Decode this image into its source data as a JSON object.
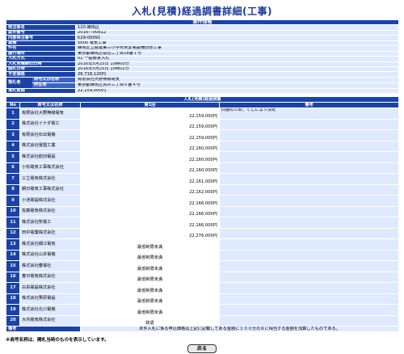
{
  "page_title": "入札(見積)経過調書詳細(工事)",
  "case_info": {
    "section_title": "案件情報",
    "rows": [
      {
        "label": "発注係名",
        "value": "120 練馬区"
      },
      {
        "label": "案件番号",
        "value": "2016---00812"
      },
      {
        "label": "内部発注番号",
        "value": "K28-00091"
      },
      {
        "label": "業種",
        "value": "5600 電気工事"
      },
      {
        "label": "件名",
        "value": "練馬区立開進第三小学校受変電設備改修工事"
      },
      {
        "label": "履行場所",
        "value": "東京都練馬区桜台二丁目18番１号"
      },
      {
        "label": "入札方式",
        "value": "01 一般競争入札"
      },
      {
        "label": "入札見積締切日時",
        "value": "2016年5月25日 10時00分"
      },
      {
        "label": "開札日時",
        "value": "2016年5月25日 10時02分"
      },
      {
        "label": "予定価格",
        "value": "26,718,120円"
      }
    ],
    "winner": {
      "label": "落札者",
      "sub1_label": "商号又は名称",
      "sub1_value": "有限会社大野無線電気",
      "sub2_label": "所在地",
      "sub2_value": "東京都練馬区貫井三丁目６番４号"
    },
    "price_label": "落札金額",
    "price_value": "22,159,000円"
  },
  "bid_table": {
    "section_title": "入札(見積)経過調書",
    "headers": {
      "no": "No",
      "name": "商号又は名称",
      "round": "第1回",
      "note": "備考"
    },
    "rows": [
      {
        "no": "1",
        "name": "有限会社大野無線電気",
        "amount": "22,159,000円",
        "note": "同額のため、くじにより決定"
      },
      {
        "no": "2",
        "name": "株式会社イナダ電工",
        "amount": "22,159,000円",
        "note": ""
      },
      {
        "no": "3",
        "name": "有限会社石出電機",
        "amount": "22,159,000円",
        "note": ""
      },
      {
        "no": "4",
        "name": "株式会社電盟工業",
        "amount": "22,160,000円",
        "note": ""
      },
      {
        "no": "5",
        "name": "株式会社欽旧電設",
        "amount": "22,160,000円",
        "note": ""
      },
      {
        "no": "6",
        "name": "小松電気工事株式会社",
        "amount": "22,160,000円",
        "note": ""
      },
      {
        "no": "7",
        "name": "三立電気株式会社",
        "amount": "22,161,000円",
        "note": ""
      },
      {
        "no": "8",
        "name": "朝日電気工事株式会社",
        "amount": "22,162,000円",
        "note": ""
      },
      {
        "no": "9",
        "name": "小池電設株式会社",
        "amount": "22,166,000円",
        "note": ""
      },
      {
        "no": "10",
        "name": "佐藤電気株式会社",
        "amount": "22,166,000円",
        "note": ""
      },
      {
        "no": "11",
        "name": "株式会社牧電工",
        "amount": "22,166,000円",
        "note": ""
      },
      {
        "no": "12",
        "name": "田中電業株式会社",
        "amount": "22,276,000円",
        "note": ""
      },
      {
        "no": "13",
        "name": "株式会社細江電気",
        "amount": "最低制限未満",
        "note": ""
      },
      {
        "no": "14",
        "name": "株式会社山本電機",
        "amount": "最低制限未満",
        "note": ""
      },
      {
        "no": "15",
        "name": "株式会社春電社",
        "amount": "最低制限未満",
        "note": ""
      },
      {
        "no": "16",
        "name": "春日電気株式会社",
        "amount": "最低制限未満",
        "note": ""
      },
      {
        "no": "17",
        "name": "白鳥電設株式会社",
        "amount": "最低制限未満",
        "note": ""
      },
      {
        "no": "18",
        "name": "株式会社栗原電設",
        "amount": "最低制限未満",
        "note": ""
      },
      {
        "no": "19",
        "name": "株式会社北川電機",
        "amount": "最低制限未満",
        "note": ""
      },
      {
        "no": "20",
        "name": "大内電気株式会社",
        "amount": "辞退",
        "note": ""
      }
    ],
    "remark_label": "備考",
    "remark_text": "本件入札に係る申込価格は上記に記載してある金額に１００分の８に相当する金額を加算したものである。"
  },
  "footnote": "※商号名称は、開札当時のものを表示しています。",
  "back_button": "戻る"
}
